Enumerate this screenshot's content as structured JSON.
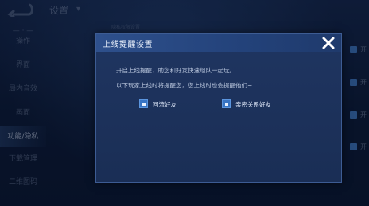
{
  "header": {
    "title": "设置"
  },
  "sidebar": {
    "items": [
      {
        "label": "— · —"
      },
      {
        "label": "操作"
      },
      {
        "label": "界面"
      },
      {
        "label": "局内音效"
      },
      {
        "label": "画面"
      },
      {
        "label": "功能/隐私"
      },
      {
        "label": "下载管理"
      },
      {
        "label": "二维图码"
      }
    ]
  },
  "background": {
    "faint_label": "隐私权限设置",
    "right_items": [
      {
        "label": "开"
      },
      {
        "label": "开"
      },
      {
        "label": "开"
      },
      {
        "label": "开"
      }
    ]
  },
  "dialog": {
    "title": "上线提醒设置",
    "line1": "开启上线提醒，助您和好友快速组队一起玩。",
    "line2": "以下玩家上线时将提醒您，您上线时也会提醒他们~",
    "options": [
      {
        "label": "回流好友",
        "checked": true
      },
      {
        "label": "亲密关系好友",
        "checked": true
      }
    ]
  },
  "colors": {
    "accent": "#3874c4",
    "dialog_bg": "#1f3561",
    "page_bg": "#0b1a33"
  }
}
